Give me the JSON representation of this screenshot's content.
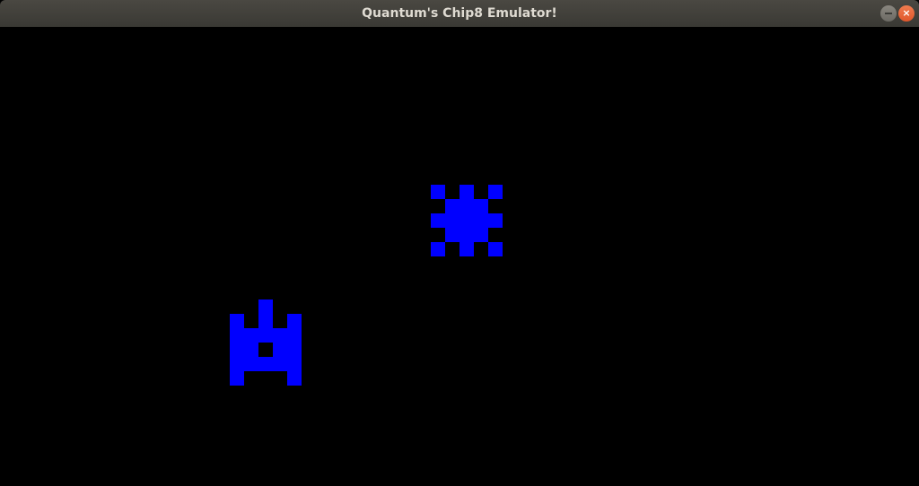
{
  "window": {
    "title": "Quantum's Chip8 Emulator!",
    "controls": {
      "minimize_icon": "minimize-icon",
      "close_icon": "close-icon",
      "close_glyph": "×"
    }
  },
  "display": {
    "columns": 64,
    "rows": 32,
    "pixel_color": "#0000ff",
    "background_color": "#000000",
    "sprites": [
      {
        "name": "enemy-sprite",
        "col": 30,
        "row": 11,
        "bitmap": [
          "10101",
          "01110",
          "11111",
          "01110",
          "10101"
        ]
      },
      {
        "name": "player-tank-sprite",
        "col": 16,
        "row": 19,
        "bitmap": [
          "00100",
          "10101",
          "11111",
          "11011",
          "11111",
          "10001"
        ]
      }
    ]
  }
}
